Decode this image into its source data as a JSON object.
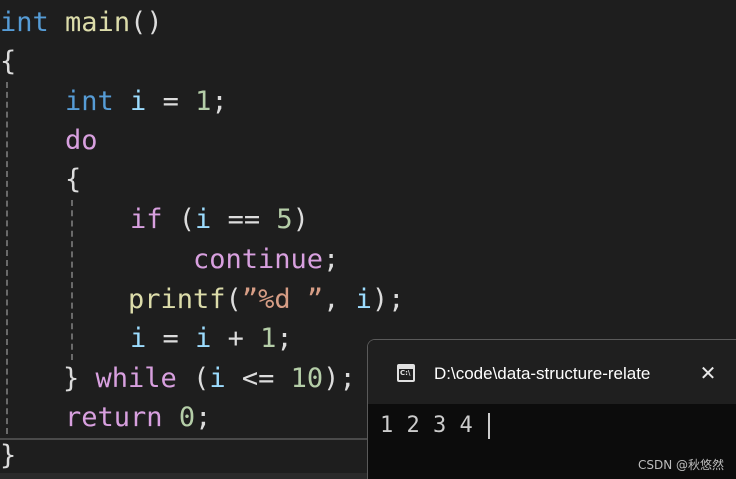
{
  "editor": {
    "lines": [
      {
        "kw_int": "int",
        "fn_main": "main",
        "parens": "()"
      },
      {
        "brace_open": "{"
      },
      {
        "kw_int": "int",
        "var_i": "i",
        "op_assign": "=",
        "num_1": "1",
        "semi": ";"
      },
      {
        "kw_do": "do"
      },
      {
        "brace_open": "{"
      },
      {
        "kw_if": "if",
        "paren_open": "(",
        "var_i": "i",
        "op_eq": "==",
        "num_5": "5",
        "paren_close": ")"
      },
      {
        "kw_continue": "continue",
        "semi": ";"
      },
      {
        "fn_printf": "printf",
        "paren_open": "(",
        "str": "”%d ”",
        "comma": ",",
        "var_i": "i",
        "paren_close": ")",
        "semi": ";"
      },
      {
        "var_i": "i",
        "op_assign": "=",
        "var_i2": "i",
        "op_plus": "+",
        "num_1": "1",
        "semi": ";"
      },
      {
        "brace_close": "}",
        "kw_while": "while",
        "paren_open": "(",
        "var_i": "i",
        "op_le": "<=",
        "num_10": "10",
        "paren_close": ")",
        "semi": ";"
      },
      {
        "kw_return": "return",
        "num_0": "0",
        "semi": ";"
      },
      {
        "brace_close": "}"
      }
    ]
  },
  "terminal": {
    "icon": "console-icon",
    "icon_glyph": "C:\\",
    "title": "D:\\code\\data-structure-relate",
    "close_icon": "✕",
    "output": "1 2 3 4 "
  },
  "watermark": "CSDN @秋悠然",
  "colors": {
    "background": "#1e1e1e",
    "keyword": "#569cd6",
    "control": "#d8a0df",
    "function": "#dcdcaa",
    "variable": "#9cdcfe",
    "number": "#b5cea8",
    "string": "#d69d85",
    "terminal_bg": "#0c0c0c"
  }
}
